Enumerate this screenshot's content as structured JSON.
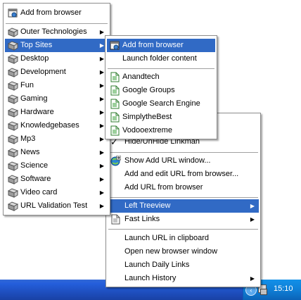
{
  "menu1": {
    "items": [
      {
        "label": "Add from browser"
      },
      {
        "label": "Outer Technologies"
      },
      {
        "label": "Top Sites"
      },
      {
        "label": "Desktop"
      },
      {
        "label": "Development"
      },
      {
        "label": "Fun"
      },
      {
        "label": "Gaming"
      },
      {
        "label": "Hardware"
      },
      {
        "label": "Knowledgebases"
      },
      {
        "label": "Mp3"
      },
      {
        "label": "News"
      },
      {
        "label": "Science"
      },
      {
        "label": "Software"
      },
      {
        "label": "Video card"
      },
      {
        "label": "URL Validation Test"
      }
    ]
  },
  "menu2": {
    "items": [
      {
        "label": "Add from browser"
      },
      {
        "label": "Launch folder content"
      },
      {
        "label": "Anandtech"
      },
      {
        "label": "Google Groups"
      },
      {
        "label": "Google Search Engine"
      },
      {
        "label": "SimplytheBest"
      },
      {
        "label": "Vodooextreme"
      }
    ]
  },
  "menu3": {
    "items": [
      {
        "label": "Hide/UnHide Linkman"
      },
      {
        "label": "Show Add URL window..."
      },
      {
        "label": "Add and edit URL from browser..."
      },
      {
        "label": "Add URL from browser"
      },
      {
        "label": "Left Treeview"
      },
      {
        "label": "Fast Links"
      },
      {
        "label": "Launch URL in clipboard"
      },
      {
        "label": "Open new browser window"
      },
      {
        "label": "Launch Daily Links"
      },
      {
        "label": "Launch History"
      }
    ]
  },
  "taskbar": {
    "clock": "15:10"
  },
  "icons": {
    "folder": "folder-icon",
    "page": "page-icon",
    "browser": "browser-add-icon",
    "globe": "globe-icon",
    "check": "check-icon"
  },
  "colors": {
    "highlight": "#316ac5",
    "taskbar": "#245edb",
    "tray": "#0f7fd6"
  }
}
